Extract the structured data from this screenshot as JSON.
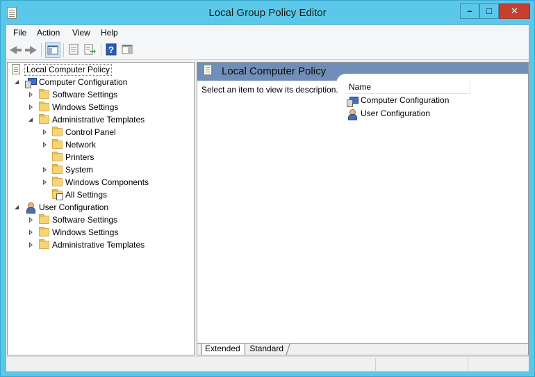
{
  "window": {
    "title": "Local Group Policy Editor",
    "controls": {
      "minimize": "–",
      "maximize": "□",
      "close": "✕"
    }
  },
  "menu": [
    "File",
    "Action",
    "View",
    "Help"
  ],
  "toolbar": [
    "back-icon",
    "forward-icon",
    "show-hide-console-tree-icon",
    "properties-icon",
    "export-list-icon",
    "help-icon",
    "show-hide-action-pane-icon"
  ],
  "tree": {
    "root": "Local Computer Policy",
    "computer_configuration": "Computer Configuration",
    "cc_software_settings": "Software Settings",
    "cc_windows_settings": "Windows Settings",
    "cc_administrative_templates": "Administrative Templates",
    "at_control_panel": "Control Panel",
    "at_network": "Network",
    "at_printers": "Printers",
    "at_system": "System",
    "at_windows_components": "Windows Components",
    "at_all_settings": "All Settings",
    "user_configuration": "User Configuration",
    "uc_software_settings": "Software Settings",
    "uc_windows_settings": "Windows Settings",
    "uc_administrative_templates": "Administrative Templates"
  },
  "content": {
    "title": "Local Computer Policy",
    "description": "Select an item to view its description.",
    "column_name": "Name",
    "items": [
      "Computer Configuration",
      "User Configuration"
    ]
  },
  "tabs": {
    "extended": "Extended",
    "standard": "Standard"
  }
}
